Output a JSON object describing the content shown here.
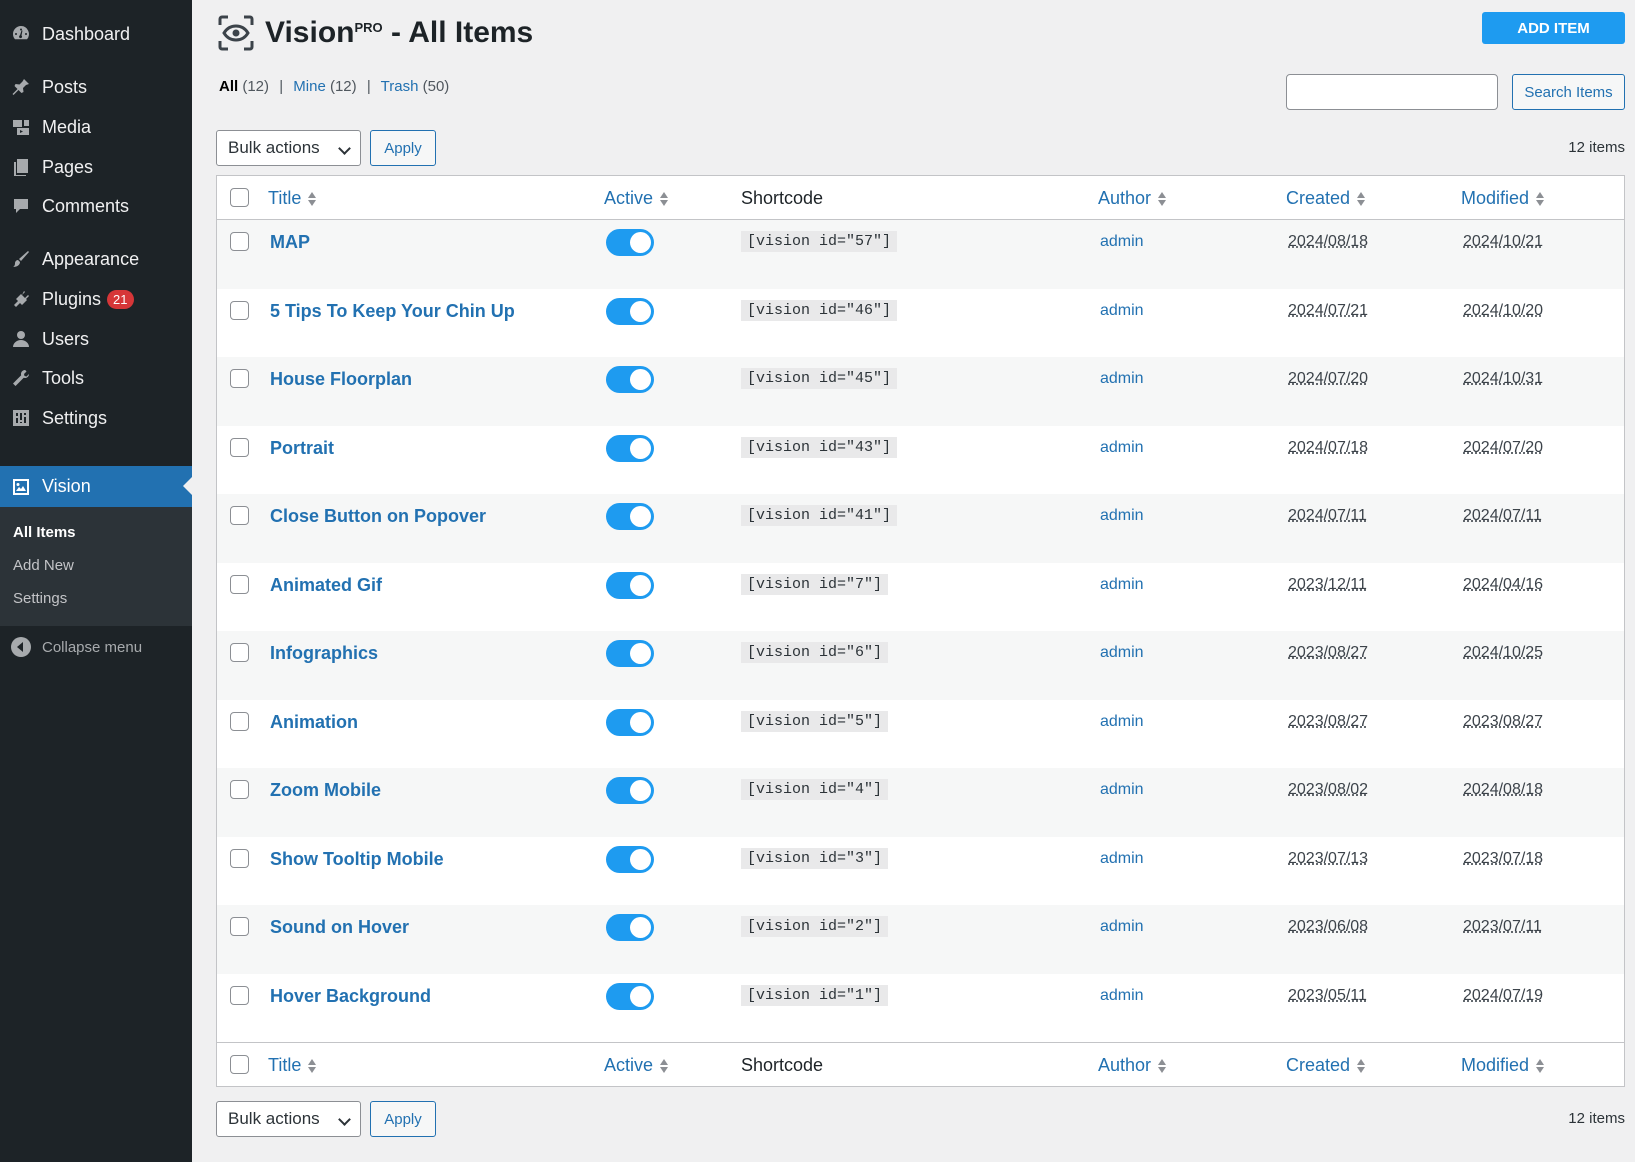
{
  "sidebar": {
    "items": [
      {
        "label": "Dashboard",
        "icon": "dashboard-icon"
      },
      {
        "label": "Posts",
        "icon": "pin-icon"
      },
      {
        "label": "Media",
        "icon": "media-icon"
      },
      {
        "label": "Pages",
        "icon": "pages-icon"
      },
      {
        "label": "Comments",
        "icon": "comment-icon"
      },
      {
        "label": "Appearance",
        "icon": "brush-icon"
      },
      {
        "label": "Plugins",
        "icon": "plugin-icon",
        "badge": "21"
      },
      {
        "label": "Users",
        "icon": "user-icon"
      },
      {
        "label": "Tools",
        "icon": "wrench-icon"
      },
      {
        "label": "Settings",
        "icon": "settings-icon"
      },
      {
        "label": "Vision",
        "icon": "image-icon",
        "active": true
      }
    ],
    "submenu": [
      "All Items",
      "Add New",
      "Settings"
    ],
    "collapse_label": "Collapse menu"
  },
  "header": {
    "title_main": "Vision",
    "title_sup": "PRO",
    "title_rest": " - All Items",
    "add_button": "ADD ITEM"
  },
  "filters": {
    "all_label": "All",
    "all_count": "(12)",
    "mine_label": "Mine",
    "mine_count": "(12)",
    "trash_label": "Trash",
    "trash_count": "(50)",
    "separator": "|"
  },
  "search": {
    "placeholder": "",
    "button": "Search Items"
  },
  "bulk": {
    "select_label": "Bulk actions",
    "apply_label": "Apply",
    "count_label": "12 items"
  },
  "columns": {
    "title": "Title",
    "active": "Active",
    "shortcode": "Shortcode",
    "author": "Author",
    "created": "Created",
    "modified": "Modified"
  },
  "rows": [
    {
      "title": "MAP",
      "active": true,
      "shortcode": "[vision id=\"57\"]",
      "author": "admin",
      "created": "2024/08/18",
      "modified": "2024/10/21"
    },
    {
      "title": "5 Tips To Keep Your Chin Up",
      "active": true,
      "shortcode": "[vision id=\"46\"]",
      "author": "admin",
      "created": "2024/07/21",
      "modified": "2024/10/20"
    },
    {
      "title": "House Floorplan",
      "active": true,
      "shortcode": "[vision id=\"45\"]",
      "author": "admin",
      "created": "2024/07/20",
      "modified": "2024/10/31"
    },
    {
      "title": "Portrait",
      "active": true,
      "shortcode": "[vision id=\"43\"]",
      "author": "admin",
      "created": "2024/07/18",
      "modified": "2024/07/20"
    },
    {
      "title": "Close Button on Popover",
      "active": true,
      "shortcode": "[vision id=\"41\"]",
      "author": "admin",
      "created": "2024/07/11",
      "modified": "2024/07/11"
    },
    {
      "title": "Animated Gif",
      "active": true,
      "shortcode": "[vision id=\"7\"]",
      "author": "admin",
      "created": "2023/12/11",
      "modified": "2024/04/16"
    },
    {
      "title": "Infographics",
      "active": true,
      "shortcode": "[vision id=\"6\"]",
      "author": "admin",
      "created": "2023/08/27",
      "modified": "2024/10/25"
    },
    {
      "title": "Animation",
      "active": true,
      "shortcode": "[vision id=\"5\"]",
      "author": "admin",
      "created": "2023/08/27",
      "modified": "2023/08/27"
    },
    {
      "title": "Zoom Mobile",
      "active": true,
      "shortcode": "[vision id=\"4\"]",
      "author": "admin",
      "created": "2023/08/02",
      "modified": "2024/08/18"
    },
    {
      "title": "Show Tooltip Mobile",
      "active": true,
      "shortcode": "[vision id=\"3\"]",
      "author": "admin",
      "created": "2023/07/13",
      "modified": "2023/07/18"
    },
    {
      "title": "Sound on Hover",
      "active": true,
      "shortcode": "[vision id=\"2\"]",
      "author": "admin",
      "created": "2023/06/08",
      "modified": "2023/07/11"
    },
    {
      "title": "Hover Background",
      "active": true,
      "shortcode": "[vision id=\"1\"]",
      "author": "admin",
      "created": "2023/05/11",
      "modified": "2024/07/19"
    }
  ],
  "colors": {
    "sidebar_bg": "#1d2327",
    "accent": "#2271b1",
    "toggle_on": "#1e9bf0",
    "badge": "#d63638"
  }
}
